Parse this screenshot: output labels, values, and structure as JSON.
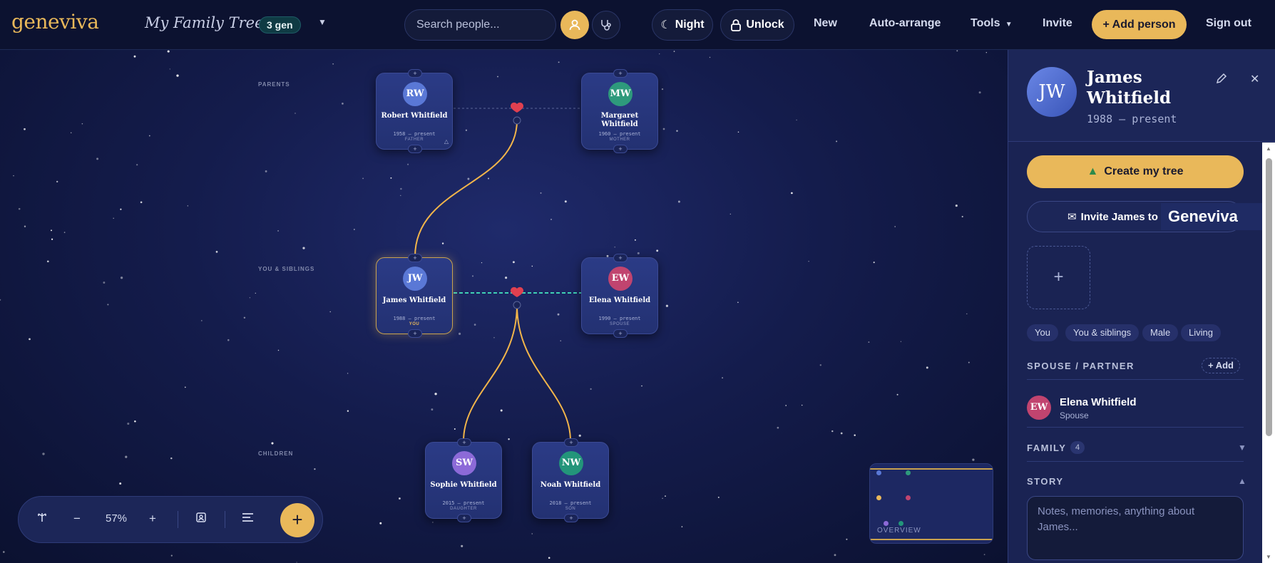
{
  "header": {
    "logo": "geneviva",
    "tree_title": "My Family Tree",
    "generations_badge": "3 gen",
    "search_placeholder": "Search people...",
    "night_label": "Night",
    "unlock_label": "Unlock",
    "nav": {
      "new": "New",
      "auto_arrange": "Auto-arrange",
      "tools": "Tools",
      "invite": "Invite",
      "add_person": "+ Add person",
      "sign_out": "Sign out"
    }
  },
  "canvas": {
    "row_labels": {
      "parents": "PARENTS",
      "you_siblings": "YOU & SIBLINGS",
      "children": "CHILDREN"
    },
    "people": [
      {
        "initials": "RW",
        "name": "Robert Whitfield",
        "dates": "1958 – present",
        "role": "FATHER",
        "color": "#5a78d6"
      },
      {
        "initials": "MW",
        "name": "Margaret Whitfield",
        "dates": "1960 – present",
        "role": "MOTHER",
        "color": "#2e9a7c"
      },
      {
        "initials": "JW",
        "name": "James Whitfield",
        "dates": "1988 – present",
        "role": "YOU",
        "color": "#5a78d6"
      },
      {
        "initials": "EW",
        "name": "Elena Whitfield",
        "dates": "1990 – present",
        "role": "SPOUSE",
        "color": "#c1446f"
      },
      {
        "initials": "SW",
        "name": "Sophie Whitfield",
        "dates": "2015 – present",
        "role": "DAUGHTER",
        "color": "#8c6ad8"
      },
      {
        "initials": "NW",
        "name": "Noah Whitfield",
        "dates": "2018 – present",
        "role": "SON",
        "color": "#23957a"
      }
    ],
    "zoom_level": "57%",
    "overview_label": "OVERVIEW"
  },
  "panel": {
    "initials": "JW",
    "name": "James Whitfield",
    "dates": "1988 – present",
    "create_tree_label": "Create my tree",
    "invite_label": "Invite James to",
    "brand_tag": "Geneviva",
    "add_photo": "+",
    "tags": [
      "You",
      "You & siblings",
      "Male",
      "Living"
    ],
    "spouse_section": "SPOUSE / PARTNER",
    "add_spouse": "+ Add",
    "spouse": {
      "initials": "EW",
      "name": "Elena Whitfield",
      "role": "Spouse"
    },
    "family_section": "FAMILY",
    "family_count": "4",
    "story_section": "STORY",
    "story_placeholder": "Notes, memories, anything about James..."
  },
  "colors": {
    "accent_gold": "#e9b85a",
    "link_line": "#f2b54a",
    "spouse_dash": "#3fd0b4",
    "heart": "#e04050"
  }
}
